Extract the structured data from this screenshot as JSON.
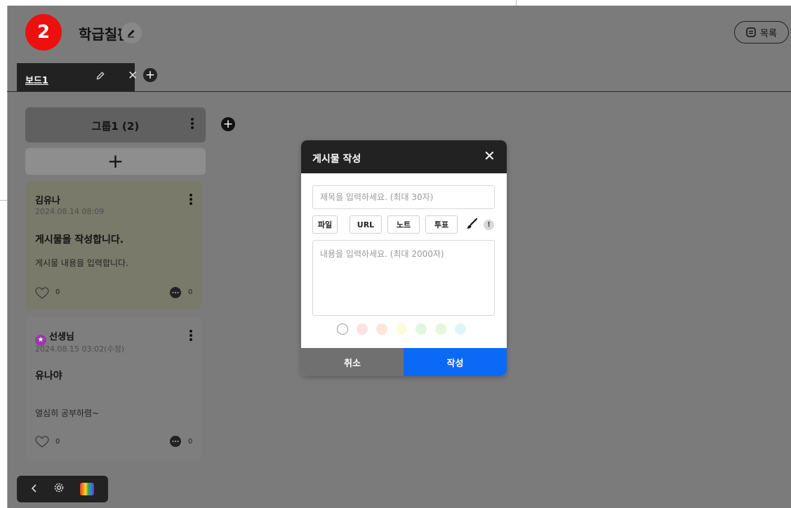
{
  "step_badge": "2",
  "header": {
    "board_title": "학급칠판",
    "list_label": "목록"
  },
  "tabs": [
    {
      "label": "보드1"
    }
  ],
  "group": {
    "title": "그룹1 (2)"
  },
  "cards": [
    {
      "author": "김유나",
      "date": "2024.08.14 08:09",
      "title": "게시물을 작성합니다.",
      "body": "게시물 내용을 입력합니다.",
      "likes": "0",
      "comments": "0"
    },
    {
      "author": "선생님",
      "date": "2024.08.15 03:02(수정)",
      "title": "유나야",
      "body": "열심히 공부하렴~",
      "likes": "0",
      "comments": "0"
    }
  ],
  "modal": {
    "title": "게시물 작성",
    "title_placeholder": "제목을 입력하세요. (최대 30자)",
    "content_placeholder": "내용을 입력하세요. (최대 2000자)",
    "tools": [
      "파일",
      "URL",
      "노트",
      "투표"
    ],
    "info_glyph": "!",
    "cancel_label": "취소",
    "submit_label": "작성",
    "colors": [
      "#ffffff",
      "#fde2e2",
      "#fde5d9",
      "#fefbd8",
      "#e1f6df",
      "#e5f8dd",
      "#def5fa"
    ]
  },
  "theme": {
    "accent": "#0a6af5",
    "badge": "#ee0f0f",
    "dark": "#222222"
  }
}
